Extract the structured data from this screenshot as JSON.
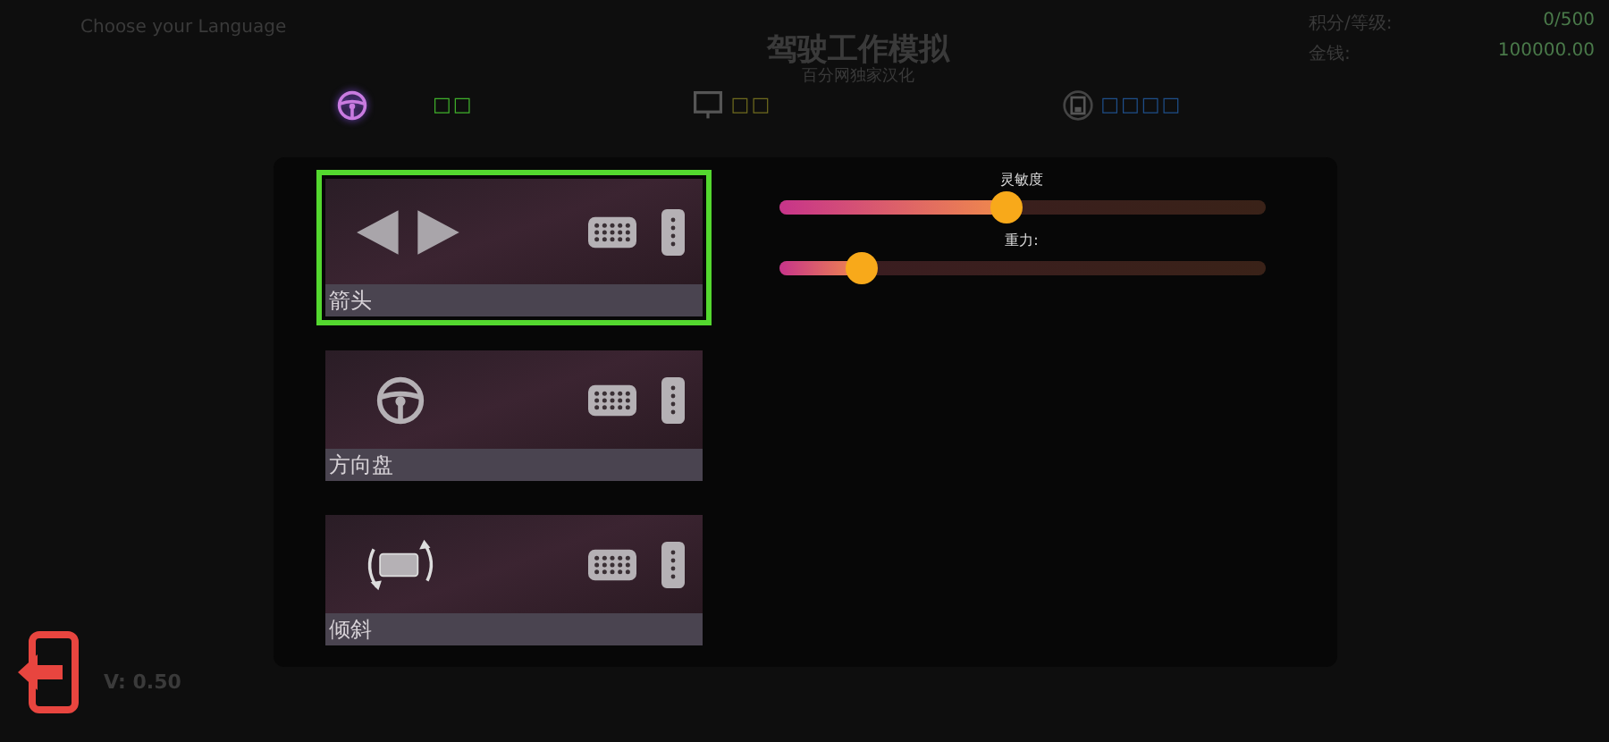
{
  "header": {
    "language_label": "Choose your Language",
    "title": "驾驶工作模拟",
    "subtitle": "百分网独家汉化",
    "stats": [
      {
        "label": "积分/等级:",
        "value": "0/500"
      },
      {
        "label": "金钱:",
        "value": "100000.00"
      }
    ]
  },
  "tabs": [
    {
      "kind": "wheel",
      "label": "□□",
      "selected": true,
      "color": "#3fae2b"
    },
    {
      "kind": "monitor",
      "label": "□□",
      "selected": false,
      "color": "#6e6a1e"
    },
    {
      "kind": "disk",
      "label": "□□□□",
      "selected": false,
      "color": "#1f4f8a"
    }
  ],
  "controls": [
    {
      "kind": "arrows",
      "label": "箭头",
      "selected": true
    },
    {
      "kind": "wheel",
      "label": "方向盘",
      "selected": false
    },
    {
      "kind": "tilt",
      "label": "倾斜",
      "selected": false
    }
  ],
  "sliders": [
    {
      "label": "灵敏度",
      "level": 0.47
    },
    {
      "label": "重力:",
      "level": 0.17
    }
  ],
  "version": "V: 0.50"
}
